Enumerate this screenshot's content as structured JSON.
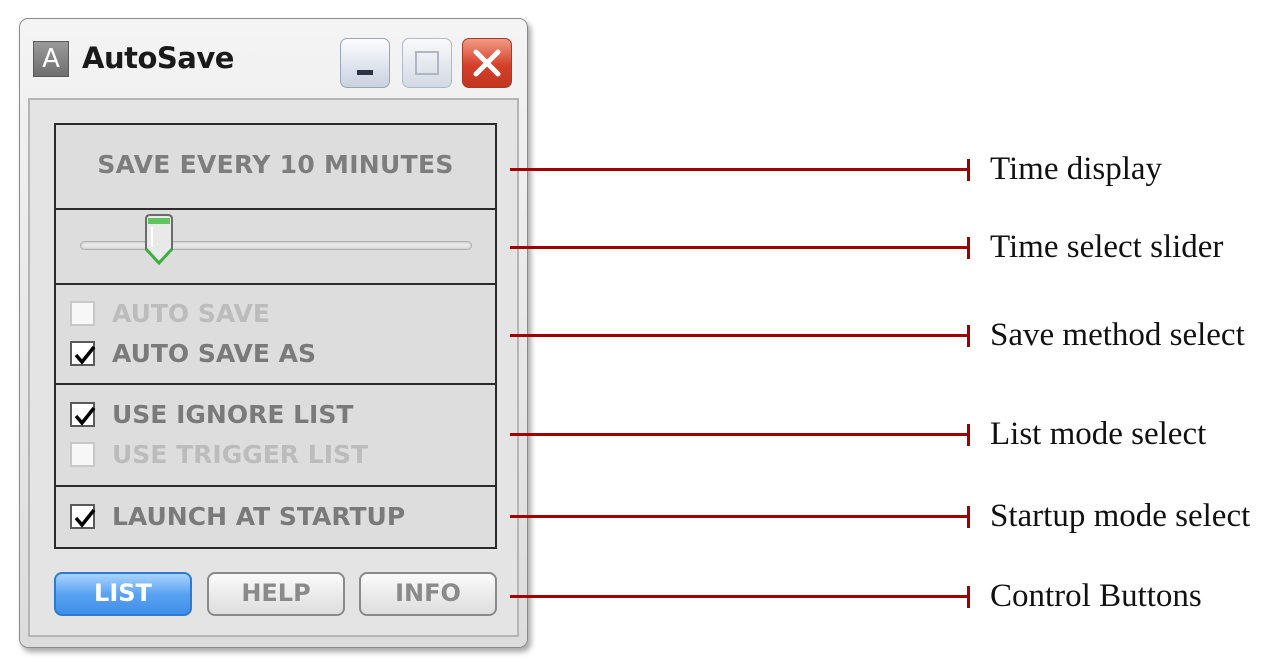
{
  "window": {
    "app_icon_letter": "A",
    "title": "AutoSave",
    "controls": [
      "minimize-icon",
      "maximize-icon",
      "close-icon"
    ]
  },
  "time_display": {
    "text": "SAVE EVERY 10 MINUTES"
  },
  "slider": {
    "value_fraction": 0.17
  },
  "save_method": {
    "options": [
      {
        "label": "AUTO SAVE",
        "checked": false,
        "enabled": false
      },
      {
        "label": "AUTO SAVE AS",
        "checked": true,
        "enabled": true
      }
    ]
  },
  "list_mode": {
    "options": [
      {
        "label": "USE IGNORE LIST",
        "checked": true,
        "enabled": true
      },
      {
        "label": "USE TRIGGER LIST",
        "checked": false,
        "enabled": false
      }
    ]
  },
  "startup_mode": {
    "options": [
      {
        "label": "LAUNCH AT STARTUP",
        "checked": true,
        "enabled": true
      }
    ]
  },
  "buttons": {
    "list": "LIST",
    "help": "HELP",
    "info": "INFO",
    "active": "list"
  },
  "callouts": [
    "Time display",
    "Time select slider",
    "Save method select",
    "List mode select",
    "Startup mode select",
    "Control Buttons"
  ],
  "colors": {
    "callout_line": "#a00000",
    "active_button": "#4a97ee",
    "panel_border": "#2b2b2b",
    "close_button": "#d4402a",
    "slider_thumb_accent": "#3fae3f"
  }
}
